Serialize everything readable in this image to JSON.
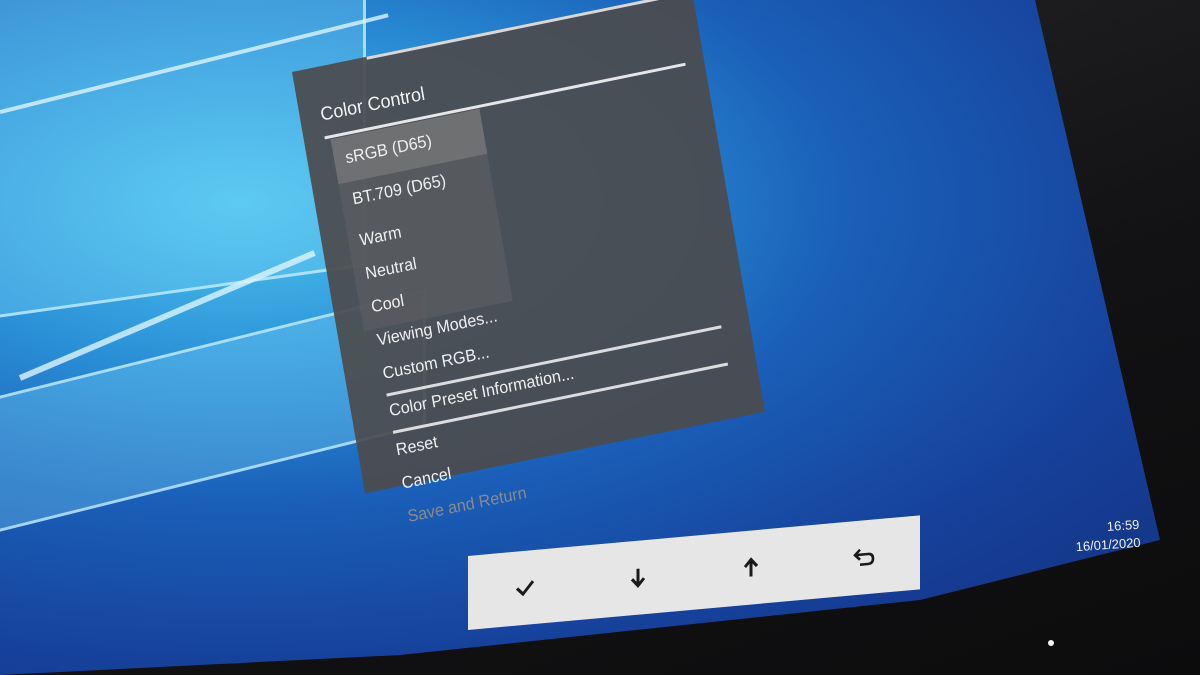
{
  "osd": {
    "title": "Color Control",
    "items": [
      {
        "label": "sRGB (D65)"
      },
      {
        "label": "BT.709 (D65)"
      },
      {
        "label": "Warm"
      },
      {
        "label": "Neutral"
      },
      {
        "label": "Cool"
      },
      {
        "label": "Viewing Modes..."
      },
      {
        "label": "Custom RGB..."
      },
      {
        "label": "Color Preset Information..."
      },
      {
        "label": "Reset"
      },
      {
        "label": "Cancel"
      },
      {
        "label": "Save and Return"
      }
    ],
    "selected_item": "sRGB (D65)",
    "disabled_item": "Save and Return"
  },
  "clock": {
    "time": "16:59",
    "date": "16/01/2020"
  },
  "buttons": [
    {
      "icon": "checkmark-icon"
    },
    {
      "icon": "arrow-down-icon"
    },
    {
      "icon": "arrow-up-icon"
    },
    {
      "icon": "return-icon"
    }
  ],
  "colors": {
    "osd_background": "#4b4b4e",
    "desktop_blue": "#1a5fb8",
    "button_bar": "#e6e6e6"
  }
}
